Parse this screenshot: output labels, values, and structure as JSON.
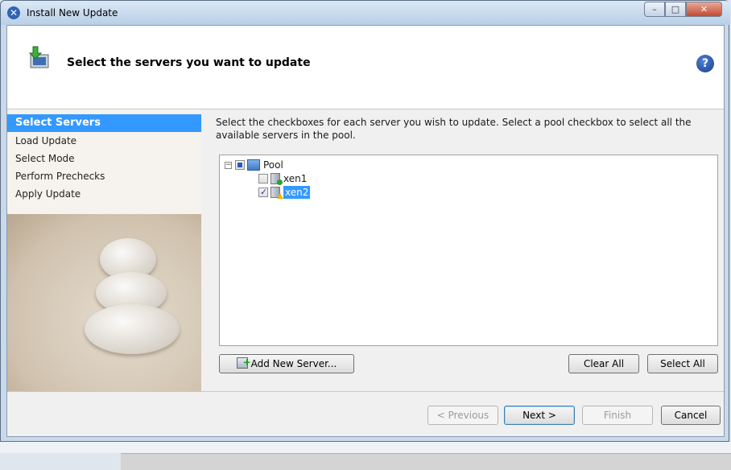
{
  "window": {
    "title": "Install New Update"
  },
  "header": {
    "title": "Select the servers you want to update"
  },
  "steps": [
    {
      "label": "Select Servers",
      "active": true
    },
    {
      "label": "Load Update",
      "active": false
    },
    {
      "label": "Select Mode",
      "active": false
    },
    {
      "label": "Perform Prechecks",
      "active": false
    },
    {
      "label": "Apply Update",
      "active": false
    }
  ],
  "content": {
    "instructions": "Select the checkboxes for each server you wish to update. Select a pool checkbox to select all the available servers in the pool.",
    "tree": {
      "pool": {
        "label": "Pool",
        "state": "partial"
      },
      "servers": [
        {
          "label": "xen1",
          "checked": false,
          "status": "ok"
        },
        {
          "label": "xen2",
          "checked": true,
          "status": "warning",
          "selected": true
        }
      ]
    },
    "buttons": {
      "add_server": "Add New Server...",
      "clear_all": "Clear All",
      "select_all": "Select All"
    }
  },
  "nav": {
    "previous": "< Previous",
    "next": "Next >",
    "finish": "Finish",
    "cancel": "Cancel"
  }
}
